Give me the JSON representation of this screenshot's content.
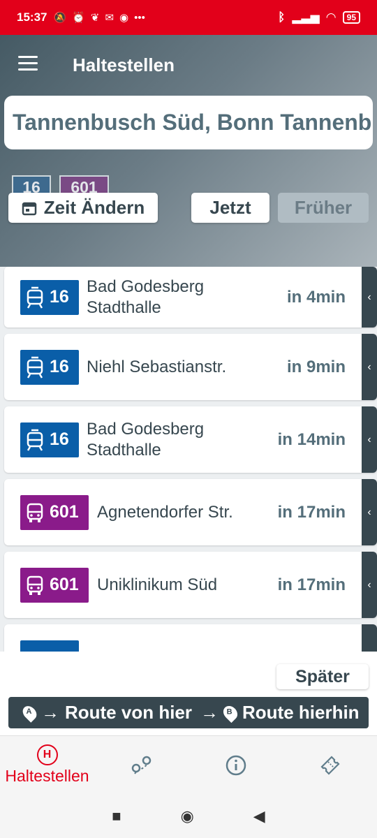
{
  "status_bar": {
    "time": "15:37",
    "icons": [
      "mute-icon",
      "alarm-icon",
      "leaf-icon",
      "mail-icon",
      "record-icon",
      "more-icon"
    ],
    "battery": "95"
  },
  "header": {
    "title": "Haltestellen",
    "stop_name": "Tannenbusch Süd, Bonn Tannenbusch"
  },
  "lines": [
    {
      "label": "16",
      "type": "tram"
    },
    {
      "label": "601",
      "type": "bus"
    }
  ],
  "controls": {
    "change_time": "Zeit Ändern",
    "now": "Jetzt",
    "earlier": "Früher",
    "later": "Später"
  },
  "departures": [
    {
      "line": "16",
      "type": "tram",
      "destination": "Bad Godesberg Stadthalle",
      "time": "in 4min"
    },
    {
      "line": "16",
      "type": "tram",
      "destination": "Niehl Sebastianstr.",
      "time": "in 9min"
    },
    {
      "line": "16",
      "type": "tram",
      "destination": "Bad Godesberg Stadthalle",
      "time": "in 14min"
    },
    {
      "line": "601",
      "type": "bus",
      "destination": "Agnetendorfer Str.",
      "time": "in 17min"
    },
    {
      "line": "601",
      "type": "bus",
      "destination": "Uniklinikum Süd",
      "time": "in 17min"
    }
  ],
  "route": {
    "from": "Route von hier",
    "to": "Route hierhin",
    "from_pin": "A",
    "to_pin": "B"
  },
  "tabs": [
    {
      "label": "Haltestellen",
      "icon": "stop-h-icon",
      "active": true
    },
    {
      "label": "",
      "icon": "route-map-icon"
    },
    {
      "label": "",
      "icon": "info-icon"
    },
    {
      "label": "",
      "icon": "ticket-icon"
    }
  ],
  "colors": {
    "accent": "#e2001a",
    "tram": "#0a5ea8",
    "bus": "#8a1b8a",
    "dark": "#37474f"
  }
}
